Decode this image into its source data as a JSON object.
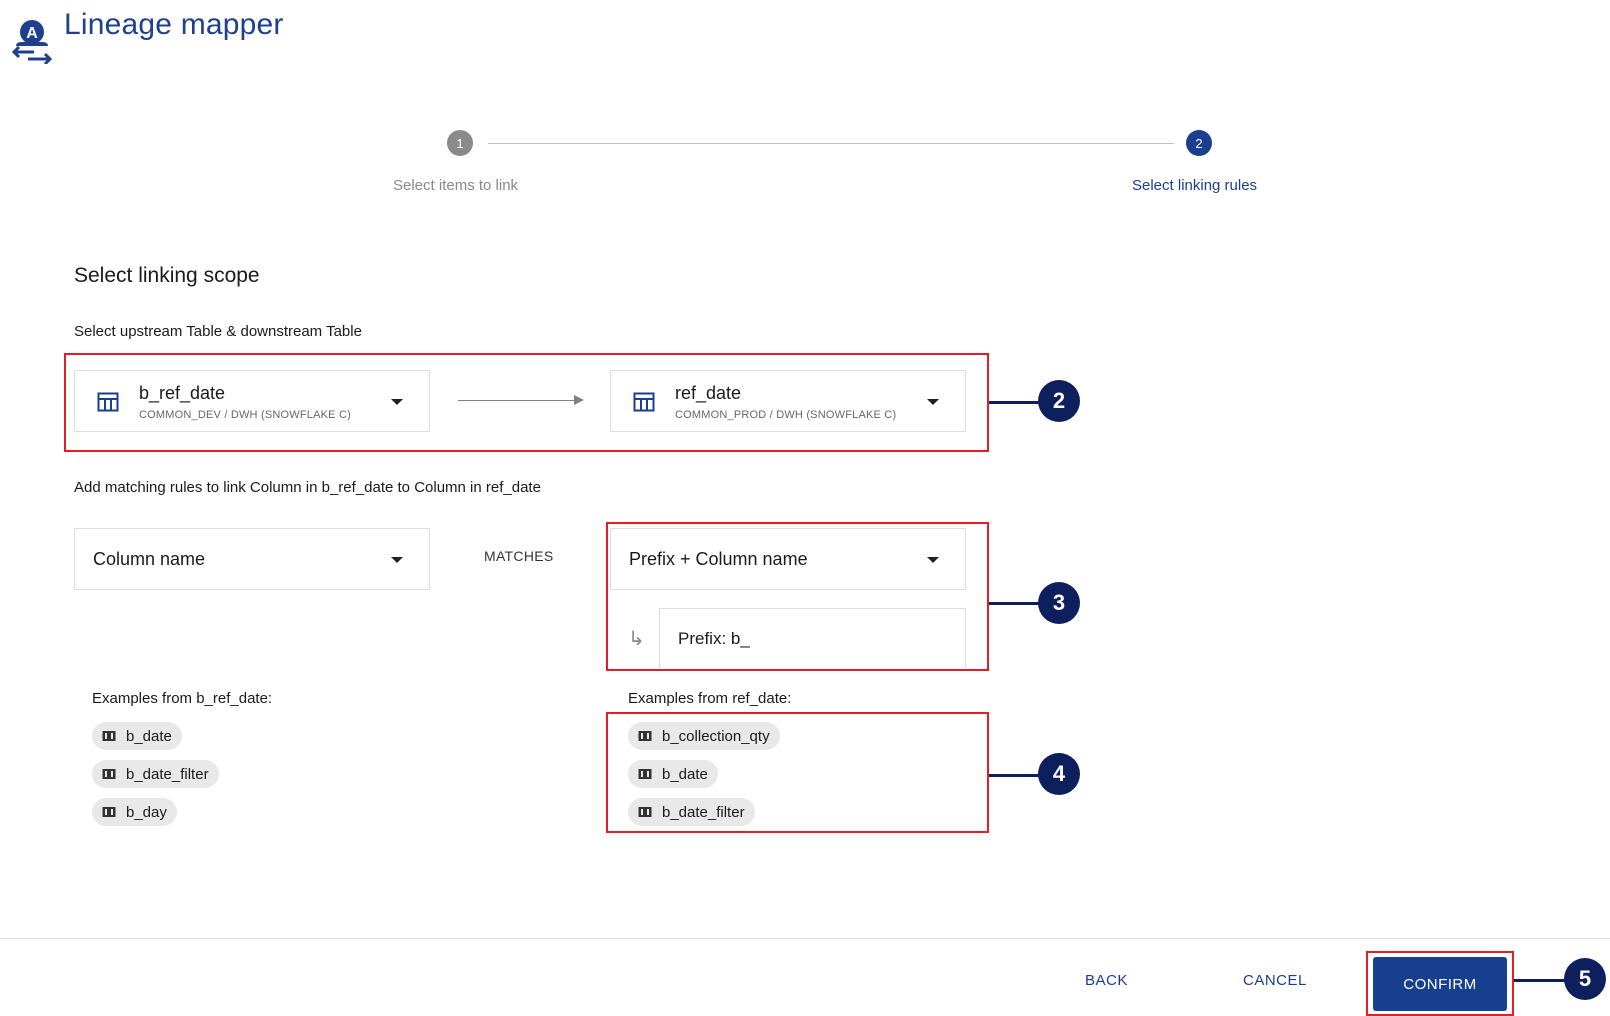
{
  "app": {
    "title": "Lineage mapper",
    "logo_letter": "A"
  },
  "stepper": {
    "steps": [
      {
        "number": "1",
        "label": "Select items to link"
      },
      {
        "number": "2",
        "label": "Select linking rules"
      }
    ]
  },
  "scope": {
    "title": "Select linking scope",
    "upstream_hint": "Select upstream Table & downstream Table",
    "upstream": {
      "name": "b_ref_date",
      "path": "COMMON_DEV / DWH (SNOWFLAKE C)"
    },
    "downstream": {
      "name": "ref_date",
      "path": "COMMON_PROD / DWH (SNOWFLAKE C)"
    }
  },
  "rules": {
    "hint": "Add matching rules to link Column in b_ref_date to Column in ref_date",
    "left_select": "Column name",
    "matches_label": "MATCHES",
    "right_select": "Prefix + Column name",
    "prefix_value": "Prefix: b_"
  },
  "examples": {
    "left_label": "Examples from b_ref_date:",
    "left_items": [
      "b_date",
      "b_date_filter",
      "b_day"
    ],
    "right_label": "Examples from ref_date:",
    "right_items": [
      "b_collection_qty",
      "b_date",
      "b_date_filter"
    ]
  },
  "annotations": [
    "2",
    "3",
    "4",
    "5"
  ],
  "footer": {
    "back": "BACK",
    "cancel": "CANCEL",
    "confirm": "CONFIRM"
  },
  "colors": {
    "brand_blue": "#1a3f91",
    "annotation_red": "#e41e26",
    "badge_navy": "#0d1f5c"
  }
}
